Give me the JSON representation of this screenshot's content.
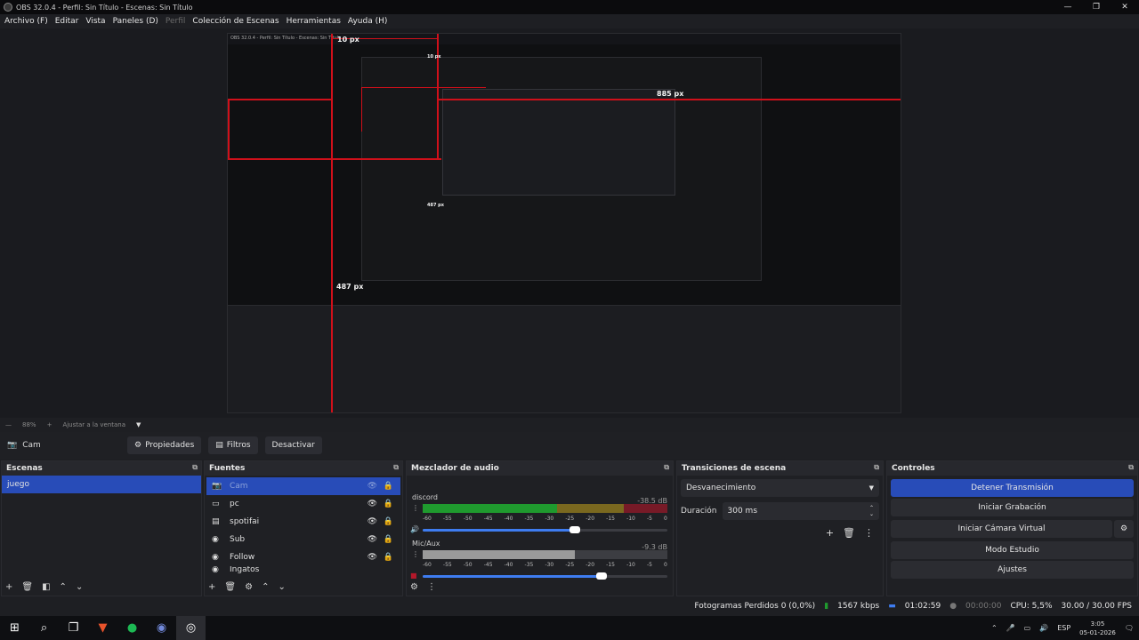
{
  "window": {
    "title": "OBS 32.0.4 - Perfil: Sin Título - Escenas: Sin Título",
    "min": "—",
    "max": "❐",
    "close": "✕"
  },
  "menu": [
    "Archivo (F)",
    "Editar",
    "Vista",
    "Paneles (D)",
    "Perfil",
    "Colección de Escenas",
    "Herramientas",
    "Ayuda (H)"
  ],
  "preview": {
    "menu_text": "OBS 32.0.4 - Perfil: Sin Título - Escenas: Sin Título",
    "labels": {
      "a": "10 px",
      "b": "885 px",
      "c": "487 px",
      "d": "487 px",
      "e": "10 px"
    }
  },
  "zoom": {
    "value": "88%",
    "fit": "Ajustar a la ventana"
  },
  "toolbar": {
    "source_name": "Cam",
    "properties": "Propiedades",
    "filters": "Filtros",
    "deactivate": "Desactivar"
  },
  "scenes": {
    "title": "Escenas",
    "items": [
      "juego"
    ]
  },
  "sources": {
    "title": "Fuentes",
    "items": [
      {
        "icon": "camera",
        "name": "Cam"
      },
      {
        "icon": "monitor",
        "name": "pc"
      },
      {
        "icon": "window",
        "name": "spotifai"
      },
      {
        "icon": "globe",
        "name": "Sub"
      },
      {
        "icon": "globe",
        "name": "Follow"
      },
      {
        "icon": "globe",
        "name": "Ingatos"
      }
    ]
  },
  "mixer": {
    "title": "Mezclador de audio",
    "channels": [
      {
        "name": "discord",
        "db": "-38.5 dB",
        "level": 0.55,
        "fader": 0.62
      },
      {
        "name": "Mic/Aux",
        "db": "-9.3 dB",
        "level": 0.62,
        "fader": 0.73
      }
    ],
    "ticks": [
      "-60",
      "-55",
      "-50",
      "-45",
      "-40",
      "-35",
      "-30",
      "-25",
      "-20",
      "-15",
      "-10",
      "-5",
      "0"
    ]
  },
  "transitions": {
    "title": "Transiciones de escena",
    "selected": "Desvanecimiento",
    "duration_label": "Duración",
    "duration_value": "300 ms"
  },
  "controls": {
    "title": "Controles",
    "buttons": [
      "Detener Transmisión",
      "Iniciar Grabación",
      "Iniciar Cámara Virtual",
      "Modo Estudio",
      "Ajustes"
    ]
  },
  "status": {
    "dropped": "Fotogramas Perdidos 0 (0,0%)",
    "bitrate": "1567 kbps",
    "stream_time": "01:02:59",
    "rec_time": "00:00:00",
    "cpu": "CPU: 5,5%",
    "fps": "30.00 / 30.00 FPS"
  },
  "tray": {
    "lang": "ESP",
    "time": "3:05",
    "date": "05-01-2026"
  },
  "colors": {
    "accent": "#284cb8",
    "red": "#d0101a",
    "meter_green": "#1f9a2e",
    "meter_yellow": "#b89a1c",
    "meter_red": "#b3182a"
  }
}
